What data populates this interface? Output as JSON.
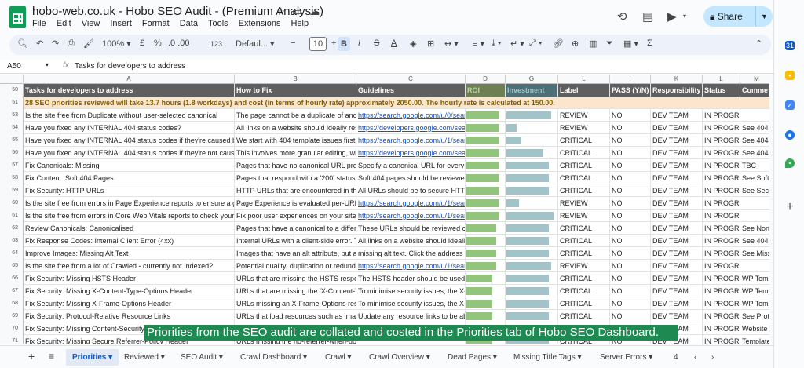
{
  "window": {
    "title": "hobo-web.co.uk - Hobo SEO Audit - (Premium Analysis)",
    "share_label": "Share"
  },
  "menus": [
    "File",
    "Edit",
    "View",
    "Insert",
    "Format",
    "Data",
    "Tools",
    "Extensions",
    "Help"
  ],
  "toolbar": {
    "zoom": "100%",
    "currency": "£",
    "percent": "%",
    "decimals": ".0  .00",
    "number_format": "123",
    "font": "Defaul...",
    "font_size": "10"
  },
  "formula_bar": {
    "cell": "A50",
    "fx": "fx",
    "value": "Tasks for developers to address"
  },
  "columns": [
    "A",
    "B",
    "C",
    "D",
    "G",
    "L",
    "I",
    "K",
    "L",
    "M"
  ],
  "header_row": {
    "num": "50",
    "cells": [
      "Tasks for developers to address",
      "How to Fix",
      "Guidelines",
      "ROI",
      "Investment",
      "Label",
      "PASS (Y/N)",
      "Responsibility",
      "Status",
      "Comme"
    ]
  },
  "note_row": {
    "num": "51",
    "text": "28 SEO priorities reviewed will take 13.7 hours (1.8 workdays) and cost (in terms of hourly rate) approximately 2050.00. The hourly rate is calculated at 150.00."
  },
  "rows": [
    {
      "num": "53",
      "task": "Is the site free from Duplicate without user-selected canonical",
      "fix": "The page cannot be a duplicate of anot",
      "guide": "https://search.google.com/u/0/sear",
      "roi": 0.9,
      "inv": 0.9,
      "label": "REVIEW",
      "pass": "NO",
      "resp": "DEV TEAM",
      "status": "IN PROGRESS",
      "comment": ""
    },
    {
      "num": "54",
      "task": "Have you fixed any INTERNAL 404 status codes?",
      "fix": "All links on a website should ideally res",
      "guide": "https://developers.google.com/sea",
      "roi": 0.9,
      "inv": 0.2,
      "label": "REVIEW",
      "pass": "NO",
      "resp": "DEV TEAM",
      "status": "IN PROGRE",
      "comment": "See 404s"
    },
    {
      "num": "55",
      "task": "Have you fixed any INTERNAL 404 status codes if they're caused b",
      "fix": "We start with 404 template issues first,",
      "guide": "https://search.google.com/u/1/sear",
      "roi": 0.9,
      "inv": 0.3,
      "label": "CRITICAL",
      "pass": "NO",
      "resp": "DEV TEAM",
      "status": "IN PROGRE",
      "comment": "See 404s"
    },
    {
      "num": "56",
      "task": "Have you fixed any INTERNAL 404 status codes if they're not cause",
      "fix": "This involves more granular editing, wi",
      "guide": "https://developers.google.com/sea",
      "roi": 0.9,
      "inv": 0.75,
      "label": "CRITICAL",
      "pass": "NO",
      "resp": "DEV TEAM",
      "status": "IN PROGRE",
      "comment": "See 404s"
    },
    {
      "num": "57",
      "task": "Fix Canonicals: Missing",
      "fix": "Pages that have no canonical URL pre",
      "guide": "Specify a canonical URL for every",
      "roi": 0.9,
      "inv": 0.85,
      "label": "CRITICAL",
      "pass": "NO",
      "resp": "DEV TEAM",
      "status": "IN PROGR",
      "comment": "TBC"
    },
    {
      "num": "58",
      "task": "Fix Content: Soft 404 Pages",
      "fix": "Pages that respond with a '200' status",
      "guide": "Soft 404 pages should be reviewed",
      "roi": 0.9,
      "inv": 0.85,
      "label": "CRITICAL",
      "pass": "NO",
      "resp": "DEV TEAM",
      "status": "IN PROGR",
      "comment": "See Soft"
    },
    {
      "num": "59",
      "task": "Fix Security: HTTP URLs",
      "fix": "HTTP URLs that are encountered in th",
      "guide": "All URLs should be to secure HTTI",
      "roi": 0.9,
      "inv": 0.85,
      "label": "CRITICAL",
      "pass": "NO",
      "resp": "DEV TEAM",
      "status": "IN PROGR",
      "comment": "See Sec"
    },
    {
      "num": "60",
      "task": "Is the site free from errors in Page Experience reports to ensure a g",
      "fix": "Page Experience is evaluated per-URL",
      "guide": "https://search.google.com/u/1/sear",
      "roi": 0.9,
      "inv": 0.25,
      "label": "REVIEW",
      "pass": "NO",
      "resp": "DEV TEAM",
      "status": "IN PROGRESS",
      "comment": ""
    },
    {
      "num": "61",
      "task": "Is the site free from errors in Core Web Vitals reports to check your",
      "fix": "Fix poor user experiences on your site",
      "guide": "https://search.google.com/u/1/sear",
      "roi": 0.9,
      "inv": 0.95,
      "label": "REVIEW",
      "pass": "NO",
      "resp": "DEV TEAM",
      "status": "IN PROGRESS",
      "comment": ""
    },
    {
      "num": "62",
      "task": "Review Canonicals: Canonicalised",
      "fix": "Pages that have a canonical to a differ",
      "guide": "These URLs should be reviewed c",
      "roi": 0.8,
      "inv": 0.85,
      "label": "CRITICAL",
      "pass": "NO",
      "resp": "DEV TEAM",
      "status": "IN PROGR",
      "comment": "See Non"
    },
    {
      "num": "63",
      "task": "Fix Response Codes: Internal Client Error (4xx)",
      "fix": "Internal URLs with a client-side error. T",
      "guide": "All links on a website should ideall",
      "roi": 0.8,
      "inv": 0.85,
      "label": "CRITICAL",
      "pass": "NO",
      "resp": "DEV TEAM",
      "status": "IN PROGR",
      "comment": "See 404s"
    },
    {
      "num": "64",
      "task": "Improve Images: Missing Alt Text",
      "fix": "Images that have an alt attribute, but are",
      "guide": "missing alt text. Click the address",
      "roi": 0.8,
      "inv": 0.85,
      "label": "CRITICAL",
      "pass": "NO",
      "resp": "DEV TEAM",
      "status": "IN PROGR",
      "comment": "See Miss"
    },
    {
      "num": "65",
      "task": "Is the site free from a lot of Crawled - currently not Indexed?",
      "fix": "Potential quality, duplication or redund",
      "guide": "https://search.google.com/u/1/sear",
      "roi": 0.8,
      "inv": 0.9,
      "label": "REVIEW",
      "pass": "NO",
      "resp": "DEV TEAM",
      "status": "IN PROGRESS",
      "comment": ""
    },
    {
      "num": "66",
      "task": "Fix Security: Missing HSTS Header",
      "fix": "URLs that are missing the HSTS respo",
      "guide": "The HSTS header should be used",
      "roi": 0.7,
      "inv": 0.85,
      "label": "CRITICAL",
      "pass": "NO",
      "resp": "DEV TEAM",
      "status": "IN PROGR",
      "comment": "WP Tem"
    },
    {
      "num": "67",
      "task": "Fix Security: Missing X-Content-Type-Options Header",
      "fix": "URLs that are missing the 'X-Content-T",
      "guide": "To minimise security issues, the X-",
      "roi": 0.7,
      "inv": 0.85,
      "label": "CRITICAL",
      "pass": "NO",
      "resp": "DEV TEAM",
      "status": "IN PROGR",
      "comment": "WP Tem"
    },
    {
      "num": "68",
      "task": "Fix Security: Missing X-Frame-Options Header",
      "fix": "URLs missing an X-Frame-Options res",
      "guide": "To minimise security issues, the X-",
      "roi": 0.7,
      "inv": 0.85,
      "label": "CRITICAL",
      "pass": "NO",
      "resp": "DEV TEAM",
      "status": "IN PROGR",
      "comment": "WP Tem"
    },
    {
      "num": "69",
      "task": "Fix Security: Protocol-Relative Resource Links",
      "fix": "URLs that load resources such as images",
      "guide": "Update any resource links to be ab",
      "roi": 0.7,
      "inv": 0.85,
      "label": "CRITICAL",
      "pass": "NO",
      "resp": "DEV TEAM",
      "status": "IN PROGR",
      "comment": "See Prot"
    },
    {
      "num": "70",
      "task": "Fix Security: Missing Content-Security",
      "fix": "",
      "guide": "",
      "roi": 0.7,
      "inv": 0.85,
      "label": "CRITICAL",
      "pass": "NO",
      "resp": "DEV TEAM",
      "status": "IN PROGR",
      "comment": "Website"
    },
    {
      "num": "71",
      "task": "Fix Security: Missing Secure Referrer-Policy Header",
      "fix": "URLs missing the no-referrer-when-do",
      "guide": "",
      "roi": 0.7,
      "inv": 0.85,
      "label": "CRITICAL",
      "pass": "NO",
      "resp": "DEV TEAM",
      "status": "IN PROGR",
      "comment": "Template"
    }
  ],
  "caption": "Priorities from the SEO audit are collated and costed in the Priorities tab of Hobo SEO Dashboard.",
  "tabs": [
    "Priorities",
    "Reviewed",
    "SEO Audit",
    "Crawl Dashboard",
    "Crawl",
    "Crawl Overview",
    "Dead Pages",
    "Missing Title Tags",
    "Server Errors",
    "4"
  ],
  "colors": {
    "roi_bar": "#93c47d",
    "investment_bar": "#a2c4c9",
    "header_bg": "#5f5f5f",
    "note_bg": "#fce5cd",
    "caption_bg": "#1e8a52",
    "share_bg": "#c2e7ff"
  }
}
